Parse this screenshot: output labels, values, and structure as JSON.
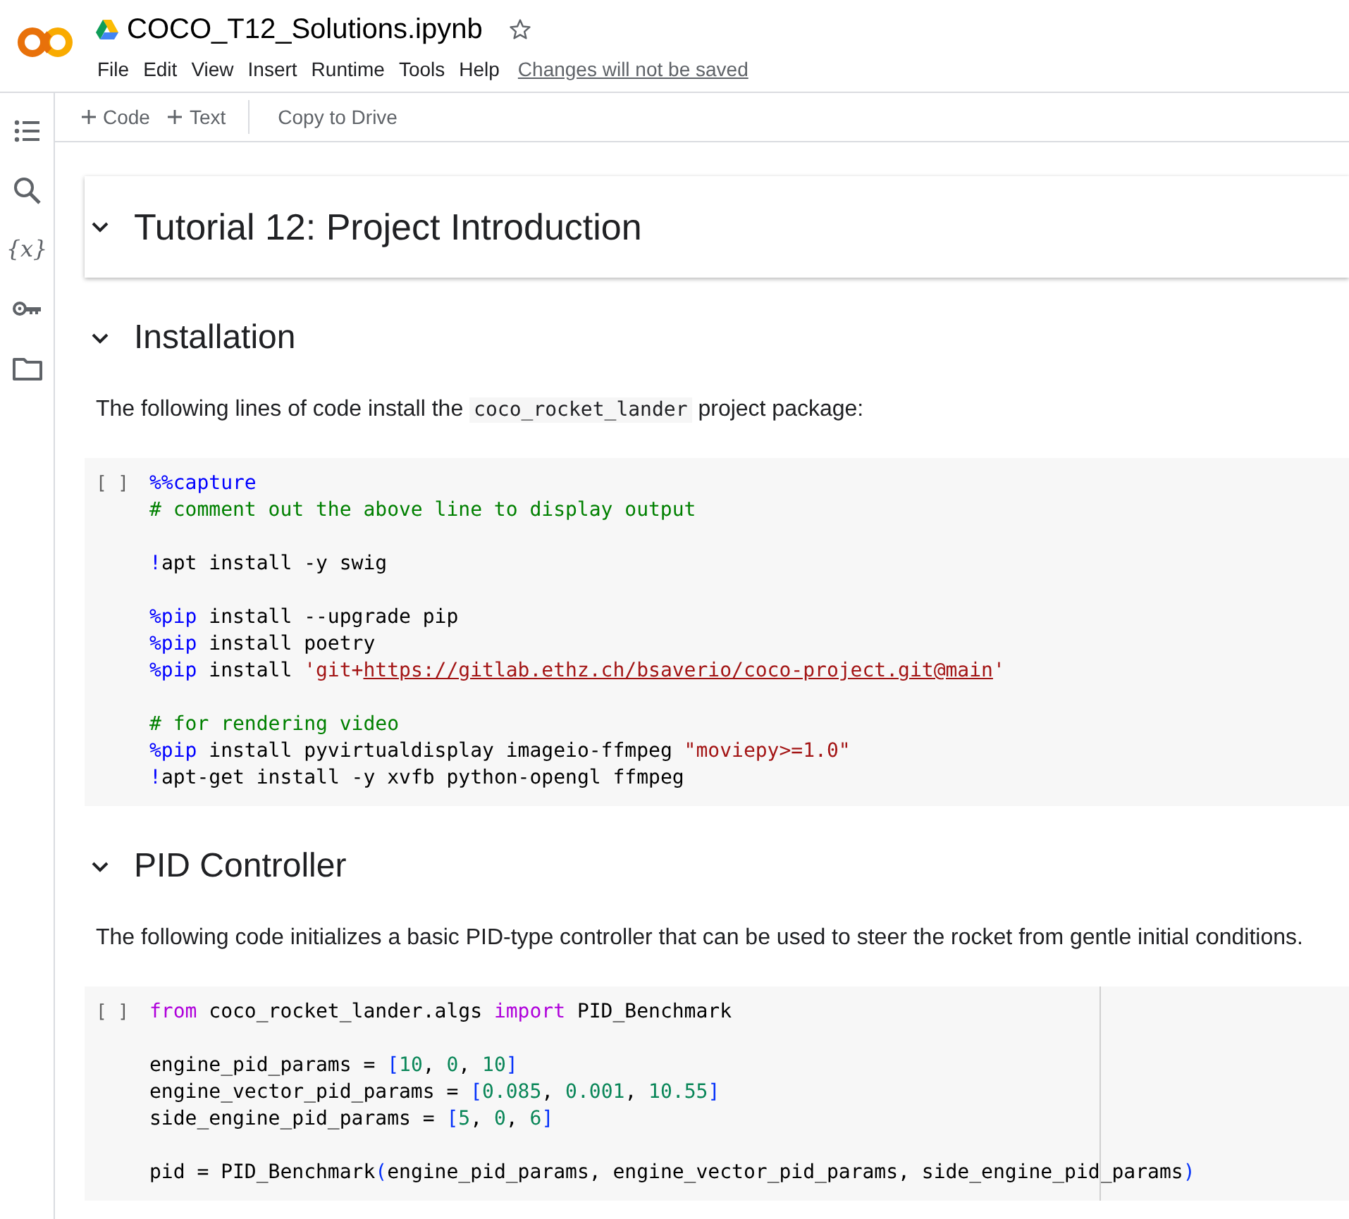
{
  "header": {
    "title": "COCO_T12_Solutions.ipynb",
    "menu": [
      "File",
      "Edit",
      "View",
      "Insert",
      "Runtime",
      "Tools",
      "Help"
    ],
    "notice": "Changes will not be saved"
  },
  "sidebar": {
    "items": [
      {
        "kind": "toc"
      },
      {
        "kind": "search"
      },
      {
        "kind": "glyph",
        "text": "{x}"
      },
      {
        "kind": "key"
      },
      {
        "kind": "folder"
      }
    ]
  },
  "toolbar": {
    "buttons": [
      {
        "kind": "add",
        "label": "Code"
      },
      {
        "kind": "add",
        "label": "Text"
      },
      {
        "kind": "plain",
        "label": "Copy to Drive"
      }
    ]
  },
  "cells": [
    {
      "kind": "title",
      "text": "Tutorial 12: Project Introduction",
      "expanded": true
    },
    {
      "kind": "heading",
      "text": "Installation",
      "expanded": true
    },
    {
      "kind": "text",
      "parts": [
        {
          "kind": "text",
          "text": "The following lines of code install the "
        },
        {
          "kind": "code",
          "text": "coco_rocket_lander"
        },
        {
          "kind": "text",
          "text": " project package:"
        }
      ]
    },
    {
      "kind": "code",
      "prompt": "[ ]",
      "ruler": false,
      "lines": [
        {
          "kind": "code",
          "tokens": [
            {
              "kind": "magic",
              "text": "%%capture"
            }
          ]
        },
        {
          "kind": "code",
          "tokens": [
            {
              "kind": "comment",
              "text": "# comment out the above line to display output"
            }
          ]
        },
        {
          "kind": "blank"
        },
        {
          "kind": "code",
          "tokens": [
            {
              "kind": "magic",
              "text": "!"
            },
            {
              "kind": "plain",
              "text": "apt install -y swig"
            }
          ]
        },
        {
          "kind": "blank"
        },
        {
          "kind": "code",
          "tokens": [
            {
              "kind": "magic",
              "text": "%pip"
            },
            {
              "kind": "plain",
              "text": " install --upgrade pip"
            }
          ]
        },
        {
          "kind": "code",
          "tokens": [
            {
              "kind": "magic",
              "text": "%pip"
            },
            {
              "kind": "plain",
              "text": " install poetry"
            }
          ]
        },
        {
          "kind": "code",
          "tokens": [
            {
              "kind": "magic",
              "text": "%pip"
            },
            {
              "kind": "plain",
              "text": " install "
            },
            {
              "kind": "string",
              "text": "'git+"
            },
            {
              "kind": "link",
              "text": "https://gitlab.ethz.ch/bsaverio/coco-project.git@main"
            },
            {
              "kind": "string",
              "text": "'"
            }
          ]
        },
        {
          "kind": "blank"
        },
        {
          "kind": "code",
          "tokens": [
            {
              "kind": "comment",
              "text": "# for rendering video"
            }
          ]
        },
        {
          "kind": "code",
          "tokens": [
            {
              "kind": "magic",
              "text": "%pip"
            },
            {
              "kind": "plain",
              "text": " install pyvirtualdisplay imageio-ffmpeg "
            },
            {
              "kind": "string",
              "text": "\"moviepy>=1.0\""
            }
          ]
        },
        {
          "kind": "code",
          "tokens": [
            {
              "kind": "magic",
              "text": "!"
            },
            {
              "kind": "plain",
              "text": "apt-get install -y xvfb python-opengl ffmpeg"
            }
          ]
        }
      ]
    },
    {
      "kind": "heading",
      "text": "PID Controller",
      "expanded": true
    },
    {
      "kind": "text",
      "parts": [
        {
          "kind": "text",
          "text": "The following code initializes a basic PID-type controller that can be used to steer the rocket from gentle initial conditions."
        }
      ]
    },
    {
      "kind": "code",
      "prompt": "[ ]",
      "ruler": true,
      "lines": [
        {
          "kind": "code",
          "tokens": [
            {
              "kind": "keyword",
              "text": "from"
            },
            {
              "kind": "plain",
              "text": " coco_rocket_lander.algs "
            },
            {
              "kind": "keyword",
              "text": "import"
            },
            {
              "kind": "plain",
              "text": " PID_Benchmark"
            }
          ]
        },
        {
          "kind": "blank"
        },
        {
          "kind": "code",
          "tokens": [
            {
              "kind": "plain",
              "text": "engine_pid_params = "
            },
            {
              "kind": "bracket",
              "text": "["
            },
            {
              "kind": "number",
              "text": "10"
            },
            {
              "kind": "plain",
              "text": ", "
            },
            {
              "kind": "number",
              "text": "0"
            },
            {
              "kind": "plain",
              "text": ", "
            },
            {
              "kind": "number",
              "text": "10"
            },
            {
              "kind": "bracket",
              "text": "]"
            }
          ]
        },
        {
          "kind": "code",
          "tokens": [
            {
              "kind": "plain",
              "text": "engine_vector_pid_params = "
            },
            {
              "kind": "bracket",
              "text": "["
            },
            {
              "kind": "number",
              "text": "0.085"
            },
            {
              "kind": "plain",
              "text": ", "
            },
            {
              "kind": "number",
              "text": "0.001"
            },
            {
              "kind": "plain",
              "text": ", "
            },
            {
              "kind": "number",
              "text": "10.55"
            },
            {
              "kind": "bracket",
              "text": "]"
            }
          ]
        },
        {
          "kind": "code",
          "tokens": [
            {
              "kind": "plain",
              "text": "side_engine_pid_params = "
            },
            {
              "kind": "bracket",
              "text": "["
            },
            {
              "kind": "number",
              "text": "5"
            },
            {
              "kind": "plain",
              "text": ", "
            },
            {
              "kind": "number",
              "text": "0"
            },
            {
              "kind": "plain",
              "text": ", "
            },
            {
              "kind": "number",
              "text": "6"
            },
            {
              "kind": "bracket",
              "text": "]"
            }
          ]
        },
        {
          "kind": "blank"
        },
        {
          "kind": "code",
          "tokens": [
            {
              "kind": "plain",
              "text": "pid = PID_Benchmark"
            },
            {
              "kind": "bracket",
              "text": "("
            },
            {
              "kind": "plain",
              "text": "engine_pid_params, engine_vector_pid_params, side_engine_pid_params"
            },
            {
              "kind": "bracket",
              "text": ")"
            }
          ]
        }
      ]
    }
  ]
}
